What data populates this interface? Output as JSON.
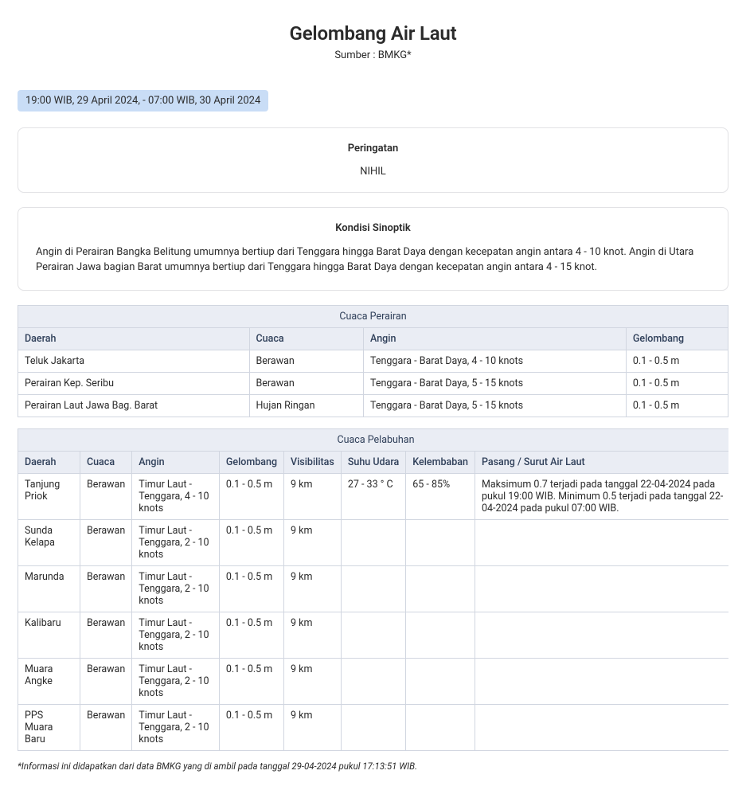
{
  "header": {
    "title": "Gelombang Air Laut",
    "subtitle": "Sumber : BMKG*"
  },
  "period": "19:00 WIB, 29 April 2024, - 07:00 WIB, 30 April 2024",
  "warning": {
    "title": "Peringatan",
    "body": "NIHIL"
  },
  "synoptic": {
    "title": "Kondisi Sinoptik",
    "body": "Angin di Perairan Bangka Belitung umumnya bertiup dari Tenggara hingga Barat Daya dengan kecepatan angin antara 4 - 10 knot. Angin di Utara Perairan Jawa bagian Barat umumnya bertiup dari Tenggara hingga Barat Daya dengan kecepatan angin antara 4 - 15 knot."
  },
  "waters": {
    "caption": "Cuaca Perairan",
    "headers": [
      "Daerah",
      "Cuaca",
      "Angin",
      "Gelombang"
    ],
    "rows": [
      [
        "Teluk Jakarta",
        "Berawan",
        "Tenggara - Barat Daya, 4 - 10 knots",
        "0.1 - 0.5 m"
      ],
      [
        "Perairan Kep. Seribu",
        "Berawan",
        "Tenggara - Barat Daya, 5 - 15 knots",
        "0.1 - 0.5 m"
      ],
      [
        "Perairan Laut Jawa Bag. Barat",
        "Hujan Ringan",
        "Tenggara - Barat Daya, 5 - 15 knots",
        "0.1 - 0.5 m"
      ]
    ]
  },
  "ports": {
    "caption": "Cuaca Pelabuhan",
    "headers": [
      "Daerah",
      "Cuaca",
      "Angin",
      "Gelombang",
      "Visibilitas",
      "Suhu Udara",
      "Kelembaban",
      "Pasang / Surut Air Laut"
    ],
    "rows": [
      [
        "Tanjung Priok",
        "Berawan",
        "Timur Laut - Tenggara, 4 - 10 knots",
        "0.1 - 0.5 m",
        "9 km",
        "27 - 33 ° C",
        "65 - 85%",
        "Maksimum 0.7 terjadi pada tanggal 22-04-2024 pada pukul 19:00 WIB. Minimum 0.5 terjadi pada tanggal 22-04-2024 pada pukul 07:00 WIB."
      ],
      [
        "Sunda Kelapa",
        "Berawan",
        "Timur Laut - Tenggara, 2 - 10 knots",
        "0.1 - 0.5 m",
        "9 km",
        "",
        "",
        ""
      ],
      [
        "Marunda",
        "Berawan",
        "Timur Laut - Tenggara, 2 - 10 knots",
        "0.1 - 0.5 m",
        "9 km",
        "",
        "",
        ""
      ],
      [
        "Kalibaru",
        "Berawan",
        "Timur Laut - Tenggara, 2 - 10 knots",
        "0.1 - 0.5 m",
        "9 km",
        "",
        "",
        ""
      ],
      [
        "Muara Angke",
        "Berawan",
        "Timur Laut - Tenggara, 2 - 10 knots",
        "0.1 - 0.5 m",
        "9 km",
        "",
        "",
        ""
      ],
      [
        "PPS Muara Baru",
        "Berawan",
        "Timur Laut - Tenggara, 2 - 10 knots",
        "0.1 - 0.5 m",
        "9 km",
        "",
        "",
        ""
      ]
    ]
  },
  "footnote": "*Informasi ini didapatkan dari data BMKG yang di ambil pada tanggal 29-04-2024 pukul 17:13:51 WIB."
}
